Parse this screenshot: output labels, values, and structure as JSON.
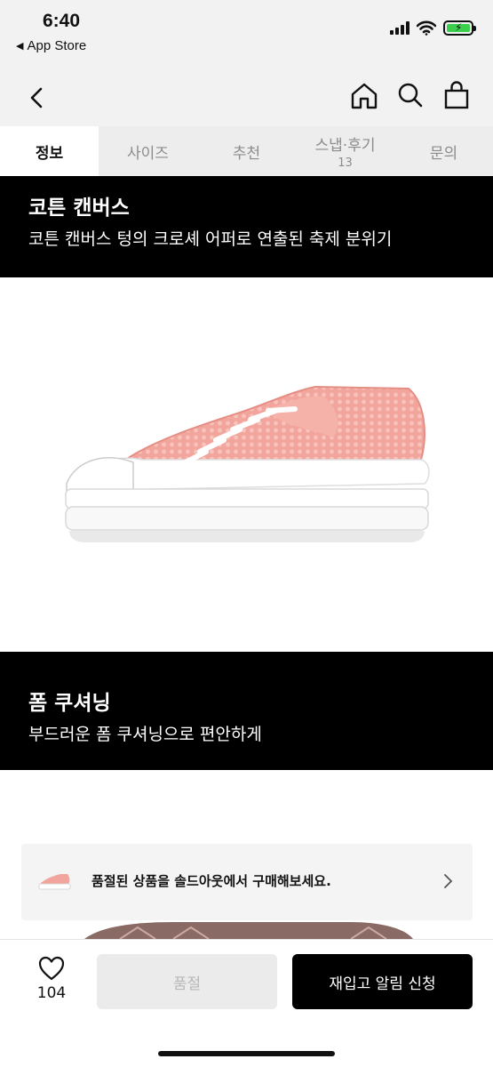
{
  "status_bar": {
    "time": "6:40",
    "back_app": "App Store"
  },
  "nav": {
    "back_icon": "chevron-left-icon",
    "icons": [
      "home-icon",
      "search-icon",
      "shopping-bag-icon"
    ]
  },
  "tabs": [
    {
      "label": "정보",
      "active": true
    },
    {
      "label": "사이즈"
    },
    {
      "label": "추천"
    },
    {
      "label": "스냅·후기",
      "count": "13"
    },
    {
      "label": "문의"
    }
  ],
  "sections": [
    {
      "title": "코튼 캔버스",
      "subtitle": "코튼 캔버스 텅의 크로셰 어퍼로 연출된 축제 분위기"
    },
    {
      "title": "폼 쿠셔닝",
      "subtitle": "부드러운 폼 쿠셔닝으로 편안하게"
    }
  ],
  "product_image": {
    "colors": {
      "upper": "#f2a59c",
      "sole": "#ffffff",
      "laces": "#ffffff"
    }
  },
  "soldout_notice": {
    "text": "품절된 상품을 솔드아웃에서 구매해보세요."
  },
  "bottom_bar": {
    "like_count": "104",
    "soldout_label": "품절",
    "restock_label": "재입고 알림 신청"
  },
  "colors": {
    "accent": "#000000",
    "banner_bg": "#000000",
    "tab_bg": "#ededed"
  }
}
